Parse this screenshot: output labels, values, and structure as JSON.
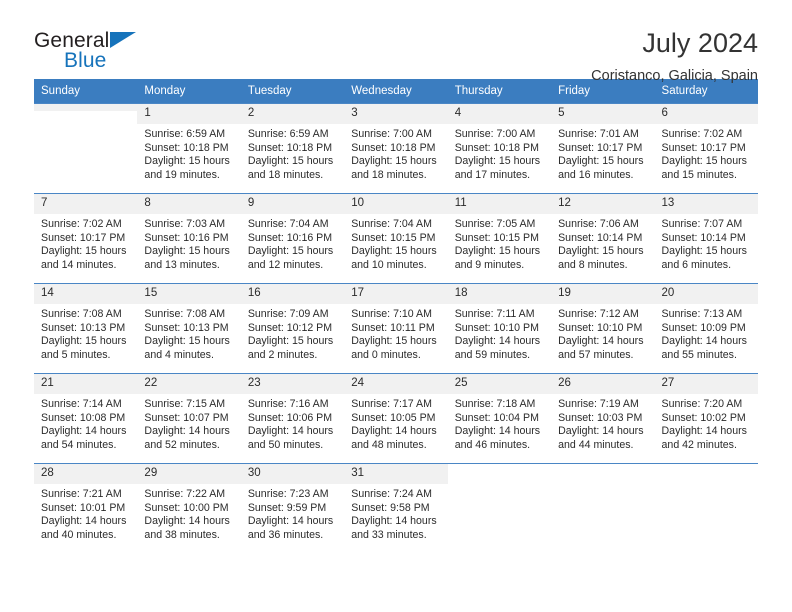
{
  "brand": {
    "name_part1": "General",
    "name_part2": "Blue",
    "logo_icon": "triangle-flag-icon",
    "accent_color": "#1673bb"
  },
  "header": {
    "title": "July 2024",
    "subtitle": "Coristanco, Galicia, Spain"
  },
  "calendar": {
    "header_bg": "#3b7dc0",
    "daynum_bg": "#f1f1f1",
    "weekday_headers": [
      "Sunday",
      "Monday",
      "Tuesday",
      "Wednesday",
      "Thursday",
      "Friday",
      "Saturday"
    ],
    "weeks": [
      [
        {
          "day": "",
          "sunrise": "",
          "sunset": "",
          "daylight1": "",
          "daylight2": "",
          "blank": true
        },
        {
          "day": "1",
          "sunrise": "Sunrise: 6:59 AM",
          "sunset": "Sunset: 10:18 PM",
          "daylight1": "Daylight: 15 hours",
          "daylight2": "and 19 minutes."
        },
        {
          "day": "2",
          "sunrise": "Sunrise: 6:59 AM",
          "sunset": "Sunset: 10:18 PM",
          "daylight1": "Daylight: 15 hours",
          "daylight2": "and 18 minutes."
        },
        {
          "day": "3",
          "sunrise": "Sunrise: 7:00 AM",
          "sunset": "Sunset: 10:18 PM",
          "daylight1": "Daylight: 15 hours",
          "daylight2": "and 18 minutes."
        },
        {
          "day": "4",
          "sunrise": "Sunrise: 7:00 AM",
          "sunset": "Sunset: 10:18 PM",
          "daylight1": "Daylight: 15 hours",
          "daylight2": "and 17 minutes."
        },
        {
          "day": "5",
          "sunrise": "Sunrise: 7:01 AM",
          "sunset": "Sunset: 10:17 PM",
          "daylight1": "Daylight: 15 hours",
          "daylight2": "and 16 minutes."
        },
        {
          "day": "6",
          "sunrise": "Sunrise: 7:02 AM",
          "sunset": "Sunset: 10:17 PM",
          "daylight1": "Daylight: 15 hours",
          "daylight2": "and 15 minutes."
        }
      ],
      [
        {
          "day": "7",
          "sunrise": "Sunrise: 7:02 AM",
          "sunset": "Sunset: 10:17 PM",
          "daylight1": "Daylight: 15 hours",
          "daylight2": "and 14 minutes."
        },
        {
          "day": "8",
          "sunrise": "Sunrise: 7:03 AM",
          "sunset": "Sunset: 10:16 PM",
          "daylight1": "Daylight: 15 hours",
          "daylight2": "and 13 minutes."
        },
        {
          "day": "9",
          "sunrise": "Sunrise: 7:04 AM",
          "sunset": "Sunset: 10:16 PM",
          "daylight1": "Daylight: 15 hours",
          "daylight2": "and 12 minutes."
        },
        {
          "day": "10",
          "sunrise": "Sunrise: 7:04 AM",
          "sunset": "Sunset: 10:15 PM",
          "daylight1": "Daylight: 15 hours",
          "daylight2": "and 10 minutes."
        },
        {
          "day": "11",
          "sunrise": "Sunrise: 7:05 AM",
          "sunset": "Sunset: 10:15 PM",
          "daylight1": "Daylight: 15 hours",
          "daylight2": "and 9 minutes."
        },
        {
          "day": "12",
          "sunrise": "Sunrise: 7:06 AM",
          "sunset": "Sunset: 10:14 PM",
          "daylight1": "Daylight: 15 hours",
          "daylight2": "and 8 minutes."
        },
        {
          "day": "13",
          "sunrise": "Sunrise: 7:07 AM",
          "sunset": "Sunset: 10:14 PM",
          "daylight1": "Daylight: 15 hours",
          "daylight2": "and 6 minutes."
        }
      ],
      [
        {
          "day": "14",
          "sunrise": "Sunrise: 7:08 AM",
          "sunset": "Sunset: 10:13 PM",
          "daylight1": "Daylight: 15 hours",
          "daylight2": "and 5 minutes."
        },
        {
          "day": "15",
          "sunrise": "Sunrise: 7:08 AM",
          "sunset": "Sunset: 10:13 PM",
          "daylight1": "Daylight: 15 hours",
          "daylight2": "and 4 minutes."
        },
        {
          "day": "16",
          "sunrise": "Sunrise: 7:09 AM",
          "sunset": "Sunset: 10:12 PM",
          "daylight1": "Daylight: 15 hours",
          "daylight2": "and 2 minutes."
        },
        {
          "day": "17",
          "sunrise": "Sunrise: 7:10 AM",
          "sunset": "Sunset: 10:11 PM",
          "daylight1": "Daylight: 15 hours",
          "daylight2": "and 0 minutes."
        },
        {
          "day": "18",
          "sunrise": "Sunrise: 7:11 AM",
          "sunset": "Sunset: 10:10 PM",
          "daylight1": "Daylight: 14 hours",
          "daylight2": "and 59 minutes."
        },
        {
          "day": "19",
          "sunrise": "Sunrise: 7:12 AM",
          "sunset": "Sunset: 10:10 PM",
          "daylight1": "Daylight: 14 hours",
          "daylight2": "and 57 minutes."
        },
        {
          "day": "20",
          "sunrise": "Sunrise: 7:13 AM",
          "sunset": "Sunset: 10:09 PM",
          "daylight1": "Daylight: 14 hours",
          "daylight2": "and 55 minutes."
        }
      ],
      [
        {
          "day": "21",
          "sunrise": "Sunrise: 7:14 AM",
          "sunset": "Sunset: 10:08 PM",
          "daylight1": "Daylight: 14 hours",
          "daylight2": "and 54 minutes."
        },
        {
          "day": "22",
          "sunrise": "Sunrise: 7:15 AM",
          "sunset": "Sunset: 10:07 PM",
          "daylight1": "Daylight: 14 hours",
          "daylight2": "and 52 minutes."
        },
        {
          "day": "23",
          "sunrise": "Sunrise: 7:16 AM",
          "sunset": "Sunset: 10:06 PM",
          "daylight1": "Daylight: 14 hours",
          "daylight2": "and 50 minutes."
        },
        {
          "day": "24",
          "sunrise": "Sunrise: 7:17 AM",
          "sunset": "Sunset: 10:05 PM",
          "daylight1": "Daylight: 14 hours",
          "daylight2": "and 48 minutes."
        },
        {
          "day": "25",
          "sunrise": "Sunrise: 7:18 AM",
          "sunset": "Sunset: 10:04 PM",
          "daylight1": "Daylight: 14 hours",
          "daylight2": "and 46 minutes."
        },
        {
          "day": "26",
          "sunrise": "Sunrise: 7:19 AM",
          "sunset": "Sunset: 10:03 PM",
          "daylight1": "Daylight: 14 hours",
          "daylight2": "and 44 minutes."
        },
        {
          "day": "27",
          "sunrise": "Sunrise: 7:20 AM",
          "sunset": "Sunset: 10:02 PM",
          "daylight1": "Daylight: 14 hours",
          "daylight2": "and 42 minutes."
        }
      ],
      [
        {
          "day": "28",
          "sunrise": "Sunrise: 7:21 AM",
          "sunset": "Sunset: 10:01 PM",
          "daylight1": "Daylight: 14 hours",
          "daylight2": "and 40 minutes."
        },
        {
          "day": "29",
          "sunrise": "Sunrise: 7:22 AM",
          "sunset": "Sunset: 10:00 PM",
          "daylight1": "Daylight: 14 hours",
          "daylight2": "and 38 minutes."
        },
        {
          "day": "30",
          "sunrise": "Sunrise: 7:23 AM",
          "sunset": "Sunset: 9:59 PM",
          "daylight1": "Daylight: 14 hours",
          "daylight2": "and 36 minutes."
        },
        {
          "day": "31",
          "sunrise": "Sunrise: 7:24 AM",
          "sunset": "Sunset: 9:58 PM",
          "daylight1": "Daylight: 14 hours",
          "daylight2": "and 33 minutes."
        },
        {
          "day": "",
          "sunrise": "",
          "sunset": "",
          "daylight1": "",
          "daylight2": "",
          "blank": true,
          "nofill": true
        },
        {
          "day": "",
          "sunrise": "",
          "sunset": "",
          "daylight1": "",
          "daylight2": "",
          "blank": true,
          "nofill": true
        },
        {
          "day": "",
          "sunrise": "",
          "sunset": "",
          "daylight1": "",
          "daylight2": "",
          "blank": true,
          "nofill": true
        }
      ]
    ]
  }
}
